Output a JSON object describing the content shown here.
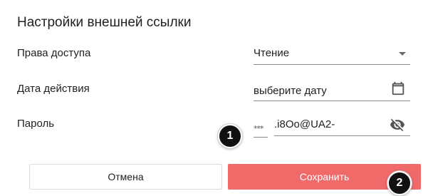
{
  "dialog": {
    "title": "Настройки внешней ссылки"
  },
  "fields": {
    "access": {
      "label": "Права доступа",
      "value": "Чтение",
      "icon": "dropdown-arrow-icon"
    },
    "date": {
      "label": "Дата действия",
      "value": "выберите дату",
      "icon": "calendar-icon"
    },
    "password": {
      "label": "Пароль",
      "prefix": "***",
      "value": ".i8Oo@UA2-",
      "icon": "eye-off-icon"
    }
  },
  "buttons": {
    "cancel": "Отмена",
    "save": "Сохранить",
    "save_color": "#f06a6a"
  },
  "annotations": {
    "badge1": "1",
    "badge2": "2"
  }
}
